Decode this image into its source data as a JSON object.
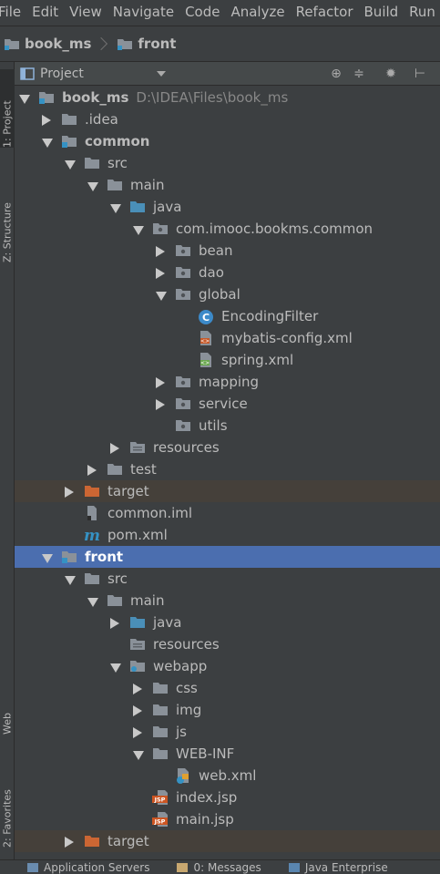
{
  "menu": [
    "File",
    "Edit",
    "View",
    "Navigate",
    "Code",
    "Analyze",
    "Refactor",
    "Build",
    "Run"
  ],
  "breadcrumb": [
    "book_ms",
    "front"
  ],
  "side_tabs": [
    "1: Project",
    "Z: Structure",
    "Web",
    "2: Favorites"
  ],
  "panel": {
    "title": "Project"
  },
  "tree": [
    {
      "label": "book_ms",
      "hint": "D:\\IDEA\\Files\\book_ms",
      "bold": true
    },
    {
      "label": ".idea"
    },
    {
      "label": "common",
      "bold": true
    },
    {
      "label": "src"
    },
    {
      "label": "main"
    },
    {
      "label": "java"
    },
    {
      "label": "com.imooc.bookms.common"
    },
    {
      "label": "bean"
    },
    {
      "label": "dao"
    },
    {
      "label": "global"
    },
    {
      "label": "EncodingFilter"
    },
    {
      "label": "mybatis-config.xml"
    },
    {
      "label": "spring.xml"
    },
    {
      "label": "mapping"
    },
    {
      "label": "service"
    },
    {
      "label": "utils"
    },
    {
      "label": "resources"
    },
    {
      "label": "test"
    },
    {
      "label": "target"
    },
    {
      "label": "common.iml"
    },
    {
      "label": "pom.xml"
    },
    {
      "label": "front",
      "bold": true
    },
    {
      "label": "src"
    },
    {
      "label": "main"
    },
    {
      "label": "java"
    },
    {
      "label": "resources"
    },
    {
      "label": "webapp"
    },
    {
      "label": "css"
    },
    {
      "label": "img"
    },
    {
      "label": "js"
    },
    {
      "label": "WEB-INF"
    },
    {
      "label": "web.xml"
    },
    {
      "label": "index.jsp"
    },
    {
      "label": "main.jsp"
    },
    {
      "label": "target"
    }
  ],
  "bottom_tabs": [
    "Application Servers",
    "0: Messages",
    "Java Enterprise"
  ],
  "colors": {
    "background": "#3c3f41",
    "selection": "#4b6eaf",
    "excluded_row": "#45403a",
    "module_folder": "#3592c4",
    "source_folder": "#4a8fb8",
    "excluded_folder": "#cc6633"
  },
  "icons": {
    "panel": "project-view-icon",
    "locate": "crosshair-icon",
    "collapse": "collapse-all-icon",
    "settings": "gear-icon",
    "hide": "hide-panel-icon"
  }
}
